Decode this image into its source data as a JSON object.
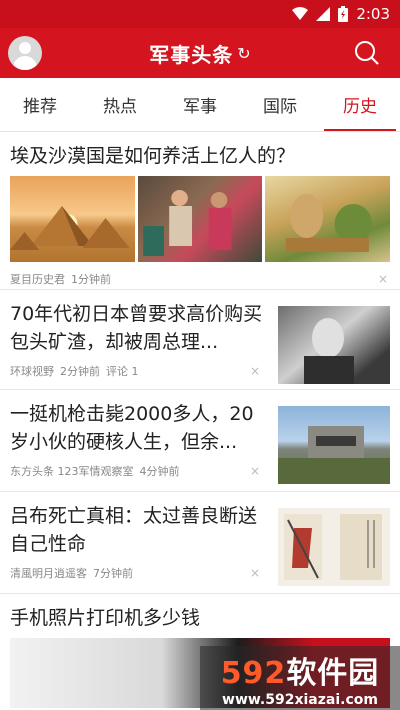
{
  "status_bar": {
    "time": "2:03"
  },
  "app_bar": {
    "title": "军事头条",
    "refresh_glyph": "↻"
  },
  "tabs": [
    {
      "label": "推荐"
    },
    {
      "label": "热点"
    },
    {
      "label": "军事"
    },
    {
      "label": "国际"
    },
    {
      "label": "历史",
      "active": true
    }
  ],
  "feed": [
    {
      "title": "埃及沙漠国是如何养活上亿人的？",
      "source": "夏目历史君",
      "time": "1分钟前",
      "images": [
        "pyramids",
        "market-people",
        "painting"
      ]
    },
    {
      "title": "70年代初日本曾要求高价购买包头矿渣，却被周总理...",
      "source": "环球视野",
      "time": "2分钟前",
      "comments": "评论 1",
      "image": "black-white-portrait"
    },
    {
      "title": "一挺机枪击毙2000多人，20岁小伙的硬核人生，但余...",
      "source": "东方头条 123军情观察室",
      "time": "4分钟前",
      "image": "bunker"
    },
    {
      "title": "吕布死亡真相：太过善良断送自己性命",
      "source": "清風明月逍遥客",
      "time": "7分钟前",
      "image": "scroll-illustration"
    },
    {
      "title": "手机照片打印机多少钱"
    }
  ],
  "close_glyph": "×",
  "watermark": {
    "main_num": "592",
    "main_text": "软件园",
    "url": "www.592xiazai.com"
  },
  "colors": {
    "brand_red": "#d4141f",
    "status_red": "#c8101d"
  }
}
